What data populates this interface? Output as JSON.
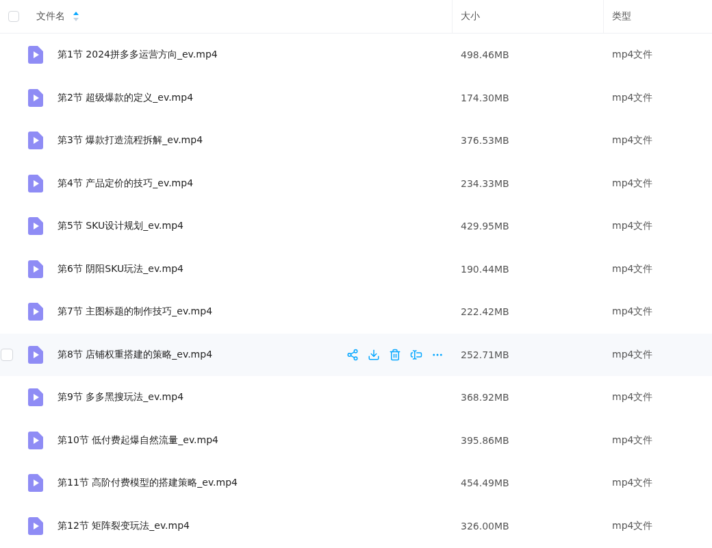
{
  "table": {
    "select_all": {
      "checked": false
    },
    "columns": [
      {
        "label": "文件名",
        "sort_ascending": true
      },
      {
        "label": "大小"
      },
      {
        "label": "类型"
      }
    ],
    "rows": [
      {
        "name": "第1节 2024拼多多运营方向_ev.mp4",
        "size": "498.46MB",
        "type": "mp4文件",
        "hovered": false
      },
      {
        "name": "第2节 超级爆款的定义_ev.mp4",
        "size": "174.30MB",
        "type": "mp4文件",
        "hovered": false
      },
      {
        "name": "第3节 爆款打造流程拆解_ev.mp4",
        "size": "376.53MB",
        "type": "mp4文件",
        "hovered": false
      },
      {
        "name": "第4节 产品定价的技巧_ev.mp4",
        "size": "234.33MB",
        "type": "mp4文件",
        "hovered": false
      },
      {
        "name": "第5节 SKU设计规划_ev.mp4",
        "size": "429.95MB",
        "type": "mp4文件",
        "hovered": false
      },
      {
        "name": "第6节 阴阳SKU玩法_ev.mp4",
        "size": "190.44MB",
        "type": "mp4文件",
        "hovered": false
      },
      {
        "name": "第7节 主图标题的制作技巧_ev.mp4",
        "size": "222.42MB",
        "type": "mp4文件",
        "hovered": false
      },
      {
        "name": "第8节 店铺权重搭建的策略_ev.mp4",
        "size": "252.71MB",
        "type": "mp4文件",
        "hovered": true
      },
      {
        "name": "第9节 多多黑搜玩法_ev.mp4",
        "size": "368.92MB",
        "type": "mp4文件",
        "hovered": false
      },
      {
        "name": "第10节 低付费起爆自然流量_ev.mp4",
        "size": "395.86MB",
        "type": "mp4文件",
        "hovered": false
      },
      {
        "name": "第11节 高阶付费模型的搭建策略_ev.mp4",
        "size": "454.49MB",
        "type": "mp4文件",
        "hovered": false
      },
      {
        "name": "第12节 矩阵裂变玩法_ev.mp4",
        "size": "326.00MB",
        "type": "mp4文件",
        "hovered": false
      }
    ]
  }
}
